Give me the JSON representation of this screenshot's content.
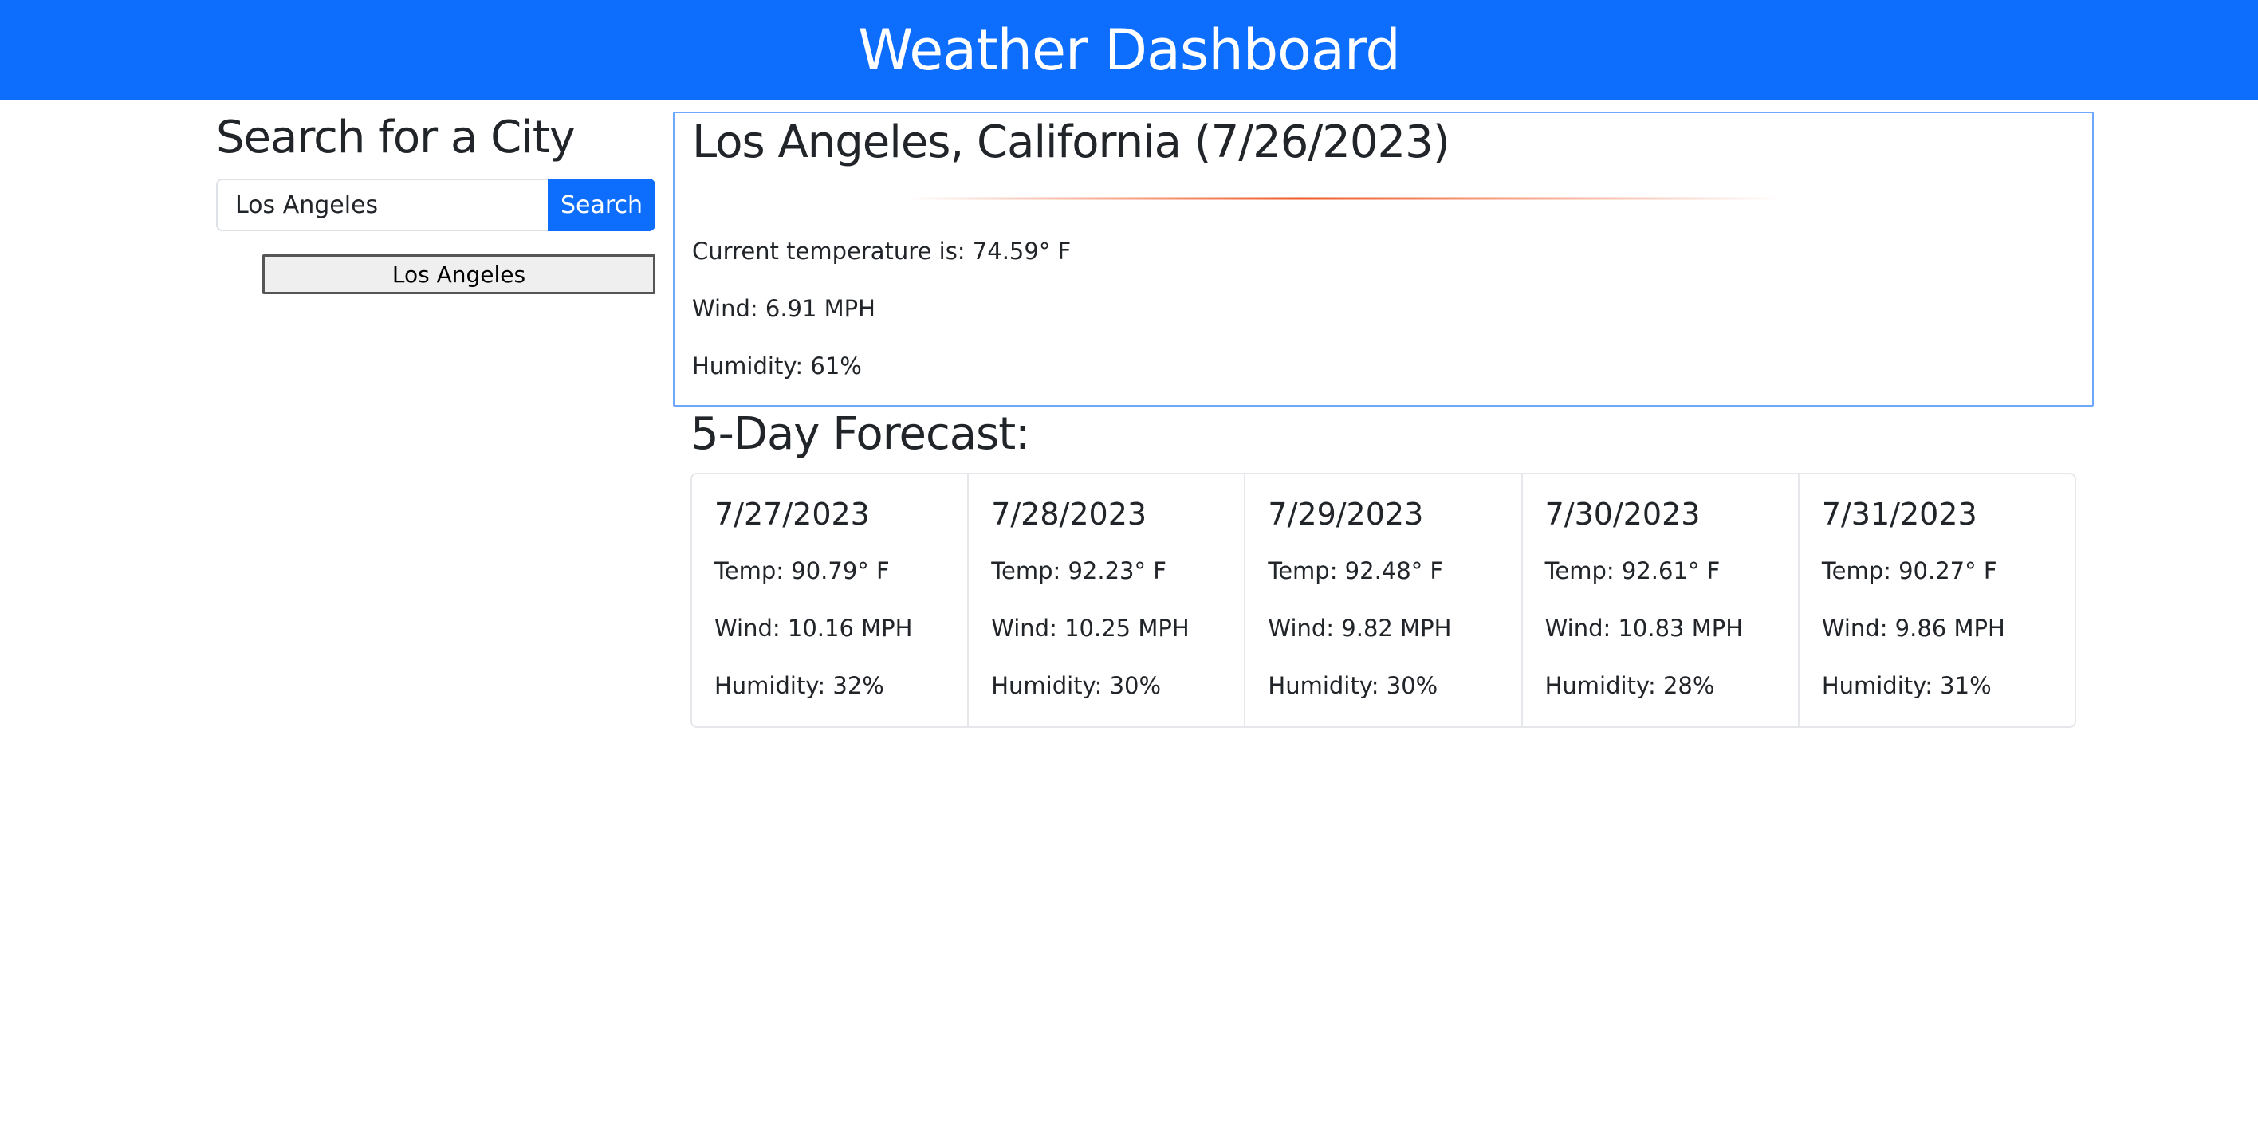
{
  "header": {
    "title": "Weather Dashboard"
  },
  "search": {
    "title": "Search for a City",
    "input_value": "Los Angeles",
    "button_label": "Search",
    "history": [
      "Los Angeles"
    ]
  },
  "current": {
    "title": "Los Angeles, California (7/26/2023)",
    "icon": "weather-icon",
    "temperature": "Current temperature is: 74.59° F",
    "wind": "Wind: 6.91 MPH",
    "humidity": "Humidity: 61%"
  },
  "forecast": {
    "title": "5-Day Forecast:",
    "days": [
      {
        "date": "7/27/2023",
        "temp": "Temp: 90.79° F",
        "wind": "Wind: 10.16 MPH",
        "humidity": "Humidity: 32%"
      },
      {
        "date": "7/28/2023",
        "temp": "Temp: 92.23° F",
        "wind": "Wind: 10.25 MPH",
        "humidity": "Humidity: 30%"
      },
      {
        "date": "7/29/2023",
        "temp": "Temp: 92.48° F",
        "wind": "Wind: 9.82 MPH",
        "humidity": "Humidity: 30%"
      },
      {
        "date": "7/30/2023",
        "temp": "Temp: 92.61° F",
        "wind": "Wind: 10.83 MPH",
        "humidity": "Humidity: 28%"
      },
      {
        "date": "7/31/2023",
        "temp": "Temp: 90.27° F",
        "wind": "Wind: 9.86 MPH",
        "humidity": "Humidity: 31%"
      }
    ]
  },
  "colors": {
    "primary": "#0d6efd",
    "card_border": "#6ea8fe",
    "accent_line": "#f05a28"
  }
}
